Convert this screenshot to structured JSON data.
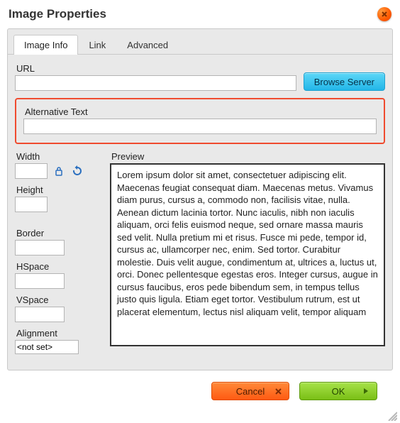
{
  "title": "Image Properties",
  "tabs": {
    "info": "Image Info",
    "link": "Link",
    "advanced": "Advanced"
  },
  "url": {
    "label": "URL",
    "value": "",
    "browse": "Browse Server"
  },
  "alt": {
    "label": "Alternative Text",
    "value": ""
  },
  "dims": {
    "width_label": "Width",
    "width_value": "",
    "height_label": "Height",
    "height_value": ""
  },
  "spacing": {
    "border_label": "Border",
    "border_value": "",
    "hspace_label": "HSpace",
    "hspace_value": "",
    "vspace_label": "VSpace",
    "vspace_value": ""
  },
  "align": {
    "label": "Alignment",
    "value": "<not set>"
  },
  "preview": {
    "label": "Preview",
    "text": "Lorem ipsum dolor sit amet, consectetuer adipiscing elit. Maecenas feugiat consequat diam. Maecenas metus. Vivamus diam purus, cursus a, commodo non, facilisis vitae, nulla. Aenean dictum lacinia tortor. Nunc iaculis, nibh non iaculis aliquam, orci felis euismod neque, sed ornare massa mauris sed velit. Nulla pretium mi et risus. Fusce mi pede, tempor id, cursus ac, ullamcorper nec, enim. Sed tortor. Curabitur molestie. Duis velit augue, condimentum at, ultrices a, luctus ut, orci. Donec pellentesque egestas eros. Integer cursus, augue in cursus faucibus, eros pede bibendum sem, in tempus tellus justo quis ligula. Etiam eget tortor. Vestibulum rutrum, est ut placerat elementum, lectus nisl aliquam velit, tempor aliquam"
  },
  "buttons": {
    "cancel": "Cancel",
    "ok": "OK"
  }
}
